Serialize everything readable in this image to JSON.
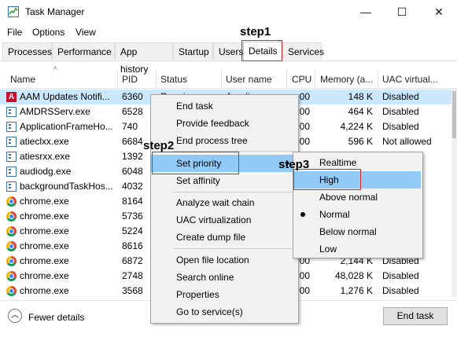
{
  "window": {
    "title": "Task Manager",
    "minimize_glyph": "—",
    "maximize_glyph": "☐",
    "close_glyph": "✕"
  },
  "menu": [
    "File",
    "Options",
    "View"
  ],
  "tabs": [
    "Processes",
    "Performance",
    "App history",
    "Startup",
    "Users",
    "Details",
    "Services"
  ],
  "active_tab": "Details",
  "columns": [
    "Name",
    "PID",
    "Status",
    "User name",
    "CPU",
    "Memory (a...",
    "UAC virtual..."
  ],
  "sort_glyph": "^",
  "rows": [
    {
      "icon": "adobe-icon",
      "name": "AAM Updates Notifi...",
      "pid": "6360",
      "status": "Running",
      "user": "Anadia",
      "cpu": "00",
      "memory": "148 K",
      "uac": "Disabled",
      "selected": true
    },
    {
      "icon": "service-icon",
      "name": "AMDRSServ.exe",
      "pid": "6528",
      "status": "",
      "user": "",
      "cpu": "00",
      "memory": "464 K",
      "uac": "Disabled"
    },
    {
      "icon": "service-icon",
      "name": "ApplicationFrameHo...",
      "pid": "740",
      "status": "",
      "user": "",
      "cpu": "00",
      "memory": "4,224 K",
      "uac": "Disabled"
    },
    {
      "icon": "service-icon",
      "name": "atieclxx.exe",
      "pid": "6684",
      "status": "",
      "user": "",
      "cpu": "00",
      "memory": "596 K",
      "uac": "Not allowed"
    },
    {
      "icon": "service-icon",
      "name": "atiesrxx.exe",
      "pid": "1392",
      "status": "",
      "user": "",
      "cpu": "",
      "memory": "",
      "uac": "ed"
    },
    {
      "icon": "service-icon",
      "name": "audiodg.exe",
      "pid": "6048",
      "status": "",
      "user": "",
      "cpu": "",
      "memory": "",
      "uac": "ed"
    },
    {
      "icon": "service-icon",
      "name": "backgroundTaskHos...",
      "pid": "4032",
      "status": "",
      "user": "",
      "cpu": "",
      "memory": "",
      "uac": ""
    },
    {
      "icon": "chrome-icon",
      "name": "chrome.exe",
      "pid": "8164",
      "status": "",
      "user": "",
      "cpu": "",
      "memory": "",
      "uac": ""
    },
    {
      "icon": "chrome-icon",
      "name": "chrome.exe",
      "pid": "5736",
      "status": "",
      "user": "",
      "cpu": "",
      "memory": "",
      "uac": ""
    },
    {
      "icon": "chrome-icon",
      "name": "chrome.exe",
      "pid": "5224",
      "status": "",
      "user": "",
      "cpu": "",
      "memory": "",
      "uac": ""
    },
    {
      "icon": "chrome-icon",
      "name": "chrome.exe",
      "pid": "8616",
      "status": "",
      "user": "",
      "cpu": "",
      "memory": "",
      "uac": ""
    },
    {
      "icon": "chrome-icon",
      "name": "chrome.exe",
      "pid": "6872",
      "status": "",
      "user": "",
      "cpu": "00",
      "memory": "2,144 K",
      "uac": "Disabled"
    },
    {
      "icon": "chrome-icon",
      "name": "chrome.exe",
      "pid": "2748",
      "status": "",
      "user": "",
      "cpu": "00",
      "memory": "48,028 K",
      "uac": "Disabled"
    },
    {
      "icon": "chrome-icon",
      "name": "chrome.exe",
      "pid": "3568",
      "status": "",
      "user": "",
      "cpu": "00",
      "memory": "1,276 K",
      "uac": "Disabled"
    }
  ],
  "context_menu": {
    "groups": [
      [
        "End task",
        "Provide feedback",
        "End process tree"
      ],
      [
        "Set priority",
        "Set affinity"
      ],
      [
        "Analyze wait chain",
        "UAC virtualization",
        "Create dump file"
      ],
      [
        "Open file location",
        "Search online",
        "Properties",
        "Go to service(s)"
      ]
    ],
    "highlighted": "Set priority"
  },
  "priority_submenu": {
    "items": [
      "Realtime",
      "High",
      "Above normal",
      "Normal",
      "Below normal",
      "Low"
    ],
    "highlighted": "High",
    "checked": "Normal"
  },
  "annotations": {
    "step1": "step1",
    "step2": "step2",
    "step3": "step3",
    "color": "#d62828"
  },
  "footer": {
    "fewer_details": "Fewer details",
    "fewer_glyph": "︿",
    "end_task": "End task"
  }
}
